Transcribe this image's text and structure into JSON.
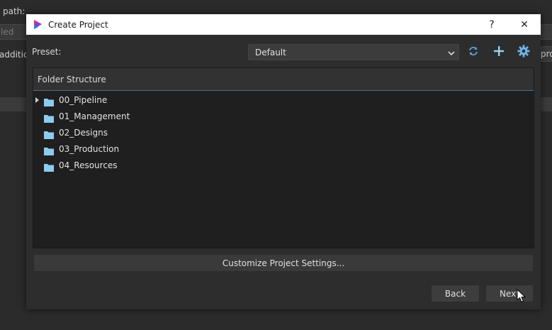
{
  "background_window": {
    "path_label": "path:",
    "field_text": "led",
    "addition_label": "additio",
    "right_cut_text": "pro"
  },
  "dialog": {
    "title": "Create Project",
    "help_symbol": "?",
    "close_symbol": "✕",
    "preset": {
      "label": "Preset:",
      "selected": "Default",
      "refresh_icon": "refresh-icon",
      "add_icon": "plus-icon",
      "settings_icon": "gear-icon"
    },
    "tree": {
      "header": "Folder Structure",
      "items": [
        {
          "label": "00_Pipeline",
          "expandable": true
        },
        {
          "label": "01_Management",
          "expandable": false
        },
        {
          "label": "02_Designs",
          "expandable": false
        },
        {
          "label": "03_Production",
          "expandable": false
        },
        {
          "label": "04_Resources",
          "expandable": false
        }
      ]
    },
    "customize_label": "Customize Project Settings...",
    "back_label": "Back",
    "next_label": "Next"
  },
  "colors": {
    "accent_line": "#4a6d8c",
    "folder": "#8ecbf0",
    "dialog_bg": "#2d2d2d",
    "titlebar_bg": "#ffffff"
  }
}
